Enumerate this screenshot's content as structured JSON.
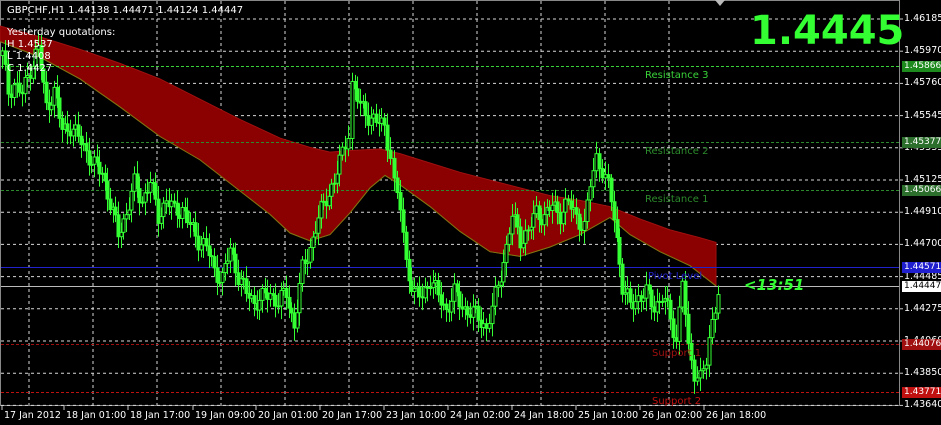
{
  "header": {
    "symbol_line": "GBPCHF,H1  1.44138 1.44471 1.44124 1.44447",
    "yesterday_title": "Yesterday quotations:",
    "high": "H 1.4537",
    "low": "L 1.4408",
    "close": "C 1.4427"
  },
  "big_price": "1.4445",
  "timer": "<13:51",
  "colors": {
    "background": "#000000",
    "candle": "#33ff33",
    "band": "#8b0000",
    "big_price": "#33ff33",
    "pivot": "#2222cc",
    "support": "#aa1111",
    "resistance": "#33aa33",
    "grid": "#ffffff"
  },
  "levels": [
    {
      "name": "Resistance 3",
      "price": 1.45866,
      "tag": "1.45866",
      "color": "#39d339",
      "tagbg": "#1c8a1c"
    },
    {
      "name": "Resistance 2",
      "price": 1.45377,
      "tag": "1.45377",
      "color": "#2c8a2c",
      "tagbg": "#2c6e2c"
    },
    {
      "name": "Resistance 1",
      "price": 1.45066,
      "tag": "1.45066",
      "color": "#2c8a2c",
      "tagbg": "#2c6e2c"
    },
    {
      "name": "Pivot Level",
      "price": 1.44571,
      "tag": "1.44571",
      "color": "#2222cc",
      "tagbg": "#1f1fcf"
    },
    {
      "name": "Support 1",
      "price": 1.44076,
      "tag": "1.44076",
      "color": "#a01010",
      "tagbg": "#a01010"
    },
    {
      "name": "Support 2",
      "price": 1.43771,
      "tag": "1.43771",
      "color": "#c01010",
      "tagbg": "#c01010"
    }
  ],
  "current_price_tag": "1.44447",
  "current_price": 1.44447,
  "price_axis": [
    "1.46185",
    "1.45970",
    "1.45760",
    "1.45545",
    "1.45335",
    "1.45125",
    "1.44910",
    "1.44700",
    "1.44485",
    "1.44275",
    "1.44060",
    "1.43850",
    "1.43640"
  ],
  "time_axis": [
    "17 Jan 2012",
    "18 Jan 01:00",
    "18 Jan 17:00",
    "19 Jan 09:00",
    "20 Jan 01:00",
    "20 Jan 17:00",
    "23 Jan 10:00",
    "24 Jan 02:00",
    "24 Jan 18:00",
    "25 Jan 10:00",
    "26 Jan 02:00",
    "26 Jan 18:00"
  ],
  "chart_data": {
    "type": "candlestick",
    "symbol": "GBPCHF",
    "timeframe": "H1",
    "ylim": [
      1.4364,
      1.4621
    ],
    "close_path": [
      [
        0,
        1.4593
      ],
      [
        6,
        1.457
      ],
      [
        12,
        1.4575
      ],
      [
        20,
        1.4568
      ],
      [
        28,
        1.4585
      ],
      [
        36,
        1.4598
      ],
      [
        44,
        1.456
      ],
      [
        52,
        1.457
      ],
      [
        60,
        1.4545
      ],
      [
        68,
        1.4548
      ],
      [
        76,
        1.454
      ],
      [
        84,
        1.4532
      ],
      [
        92,
        1.4522
      ],
      [
        100,
        1.4518
      ],
      [
        108,
        1.4498
      ],
      [
        116,
        1.4478
      ],
      [
        124,
        1.4492
      ],
      [
        132,
        1.451
      ],
      [
        140,
        1.45
      ],
      [
        148,
        1.4512
      ],
      [
        156,
        1.449
      ],
      [
        164,
        1.45
      ],
      [
        172,
        1.4493
      ],
      [
        180,
        1.4495
      ],
      [
        188,
        1.4483
      ],
      [
        196,
        1.4475
      ],
      [
        204,
        1.447
      ],
      [
        212,
        1.4455
      ],
      [
        220,
        1.445
      ],
      [
        228,
        1.4468
      ],
      [
        236,
        1.4452
      ],
      [
        244,
        1.444
      ],
      [
        252,
        1.4435
      ],
      [
        260,
        1.4437
      ],
      [
        268,
        1.444
      ],
      [
        276,
        1.4435
      ],
      [
        284,
        1.444
      ],
      [
        292,
        1.442
      ],
      [
        300,
        1.4455
      ],
      [
        308,
        1.447
      ],
      [
        316,
        1.4488
      ],
      [
        324,
        1.4502
      ],
      [
        332,
        1.4512
      ],
      [
        340,
        1.453
      ],
      [
        346,
        1.4545
      ],
      [
        350,
        1.4575
      ],
      [
        358,
        1.456
      ],
      [
        366,
        1.4555
      ],
      [
        374,
        1.455
      ],
      [
        382,
        1.4548
      ],
      [
        388,
        1.453
      ],
      [
        392,
        1.451
      ],
      [
        398,
        1.4495
      ],
      [
        404,
        1.446
      ],
      [
        412,
        1.444
      ],
      [
        420,
        1.4438
      ],
      [
        428,
        1.445
      ],
      [
        436,
        1.4438
      ],
      [
        444,
        1.443
      ],
      [
        452,
        1.444
      ],
      [
        460,
        1.4432
      ],
      [
        468,
        1.4428
      ],
      [
        476,
        1.4425
      ],
      [
        484,
        1.4418
      ],
      [
        490,
        1.443
      ],
      [
        496,
        1.4445
      ],
      [
        504,
        1.447
      ],
      [
        510,
        1.449
      ],
      [
        518,
        1.4475
      ],
      [
        526,
        1.448
      ],
      [
        534,
        1.4492
      ],
      [
        542,
        1.449
      ],
      [
        550,
        1.4496
      ],
      [
        558,
        1.4492
      ],
      [
        566,
        1.4498
      ],
      [
        574,
        1.449
      ],
      [
        582,
        1.4482
      ],
      [
        588,
        1.451
      ],
      [
        594,
        1.4528
      ],
      [
        600,
        1.452
      ],
      [
        606,
        1.4508
      ],
      [
        612,
        1.449
      ],
      [
        620,
        1.4445
      ],
      [
        628,
        1.4432
      ],
      [
        636,
        1.4438
      ],
      [
        644,
        1.444
      ],
      [
        652,
        1.4432
      ],
      [
        660,
        1.4438
      ],
      [
        668,
        1.4425
      ],
      [
        674,
        1.441
      ],
      [
        680,
        1.445
      ],
      [
        686,
        1.4402
      ],
      [
        692,
        1.439
      ],
      [
        698,
        1.4388
      ],
      [
        704,
        1.4395
      ],
      [
        710,
        1.442
      ],
      [
        716,
        1.4445
      ]
    ],
    "band_upper": [
      [
        0,
        1.4612
      ],
      [
        40,
        1.4605
      ],
      [
        80,
        1.4597
      ],
      [
        120,
        1.4588
      ],
      [
        160,
        1.4578
      ],
      [
        200,
        1.4565
      ],
      [
        240,
        1.4552
      ],
      [
        280,
        1.454
      ],
      [
        310,
        1.4534
      ],
      [
        330,
        1.4531
      ],
      [
        350,
        1.4532
      ],
      [
        380,
        1.4533
      ],
      [
        400,
        1.453
      ],
      [
        430,
        1.4524
      ],
      [
        460,
        1.4518
      ],
      [
        490,
        1.4513
      ],
      [
        520,
        1.4508
      ],
      [
        550,
        1.4503
      ],
      [
        580,
        1.45
      ],
      [
        610,
        1.4496
      ],
      [
        640,
        1.4488
      ],
      [
        670,
        1.4481
      ],
      [
        700,
        1.4476
      ],
      [
        716,
        1.4473
      ]
    ],
    "band_lower": [
      [
        0,
        1.4602
      ],
      [
        40,
        1.4592
      ],
      [
        80,
        1.4578
      ],
      [
        120,
        1.456
      ],
      [
        160,
        1.4541
      ],
      [
        200,
        1.4526
      ],
      [
        240,
        1.4506
      ],
      [
        270,
        1.4491
      ],
      [
        290,
        1.4479
      ],
      [
        310,
        1.4474
      ],
      [
        330,
        1.4478
      ],
      [
        350,
        1.4492
      ],
      [
        370,
        1.4508
      ],
      [
        385,
        1.4516
      ],
      [
        400,
        1.451
      ],
      [
        430,
        1.4496
      ],
      [
        460,
        1.448
      ],
      [
        490,
        1.4467
      ],
      [
        520,
        1.4464
      ],
      [
        550,
        1.447
      ],
      [
        580,
        1.4478
      ],
      [
        610,
        1.4489
      ],
      [
        630,
        1.4478
      ],
      [
        660,
        1.4467
      ],
      [
        690,
        1.4458
      ],
      [
        716,
        1.4445
      ]
    ]
  }
}
